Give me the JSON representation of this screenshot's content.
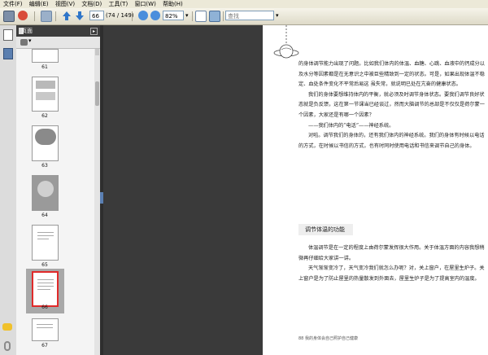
{
  "menu": [
    "文件(F)",
    "编辑(E)",
    "视图(V)",
    "文档(D)",
    "工具(T)",
    "窗口(W)",
    "帮助(H)"
  ],
  "toolbar": {
    "page_current": "66",
    "page_total": "(74 / 149)",
    "zoom": "82%",
    "search_placeholder": "查找"
  },
  "panel": {
    "title": "页面",
    "thumbnails": [
      {
        "label": "61"
      },
      {
        "label": "62"
      },
      {
        "label": "63"
      },
      {
        "label": "64"
      },
      {
        "label": "65"
      },
      {
        "label": "66",
        "selected": true
      },
      {
        "label": "67"
      }
    ]
  },
  "document": {
    "paragraphs": [
      "的身体调节能力出现了问题。比如我们体内的体温、血糖、心跳、血液中的钙成分以及水分等因素都是在无意识之中被巨些精致到一定的状态。可是，如果出现体温不稳定、血处条件变化不平常后易这 虽失常，就说明已处在亢奋的健康状态。",
      "我们的身体要想维持体内的平衡，就必须及时调节身体状态。要我们调节良好状态就是负反馈，这在第一节课当已经谈过，然而大脑调节的总部是不仅仅是荷尔蒙一个因素，大家还是有哪一个因素？",
      "——我们体内的“电话”——神经系统。",
      "对啦。调节我们的身体的，还有我们体内的神经系统。我们的身体有时候以电话的方式，在时候以书信的方式，也有时同时使用电话和书信来调节自己的身体。"
    ],
    "section_heading": "调节体温的功能",
    "paragraphs2": [
      "体温调节是在一定的程度上由荷尔蒙发挥很大作用。关于体温方面的内容我想稍微再仔细给大家讲一讲。",
      "天气渐渐变冷了，天气变冷我们就怎么办呢？对，关上窗户，在屋里生炉子。关上窗户是为了防止屋里的热量散发到外面去，屋里生炉子是为了提高室内的温度。"
    ],
    "footer": "88  我的身体会自己照护自己健康"
  }
}
